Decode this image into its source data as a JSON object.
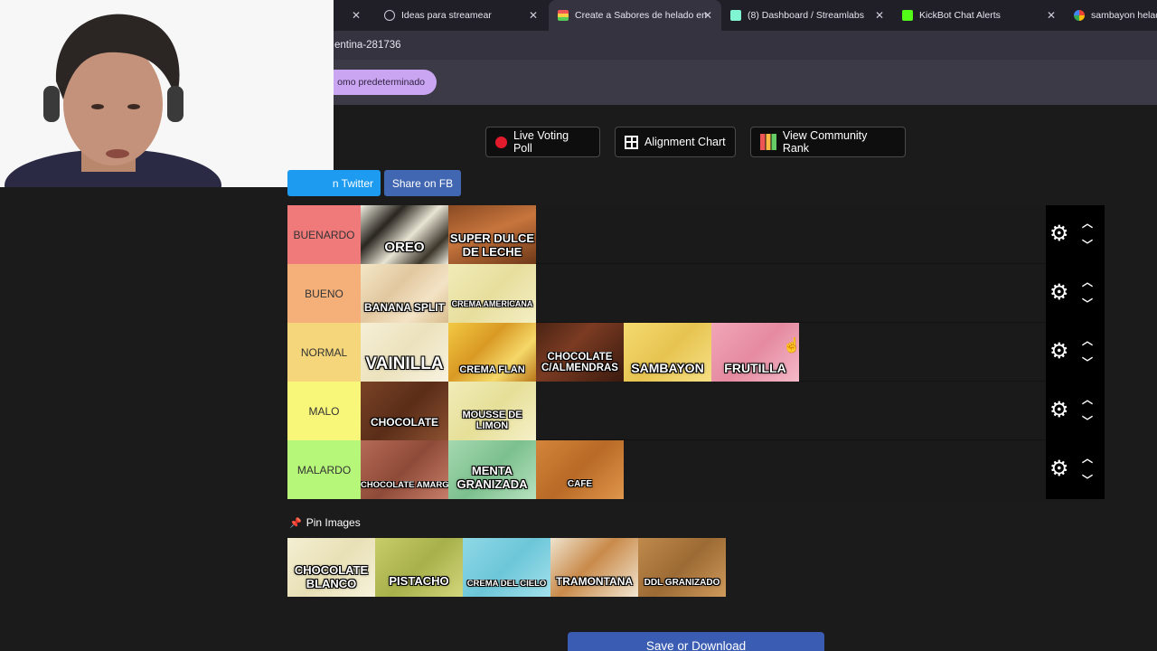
{
  "browser": {
    "tabs": [
      {
        "label": "Ideas para streamear",
        "active": false,
        "icon": "globe-icon"
      },
      {
        "label": "Create a Sabores de helado en",
        "active": true,
        "icon": "tiermaker-icon"
      },
      {
        "label": "(8) Dashboard / Streamlabs",
        "active": false,
        "icon": "streamlabs-icon"
      },
      {
        "label": "KickBot Chat Alerts",
        "active": false,
        "icon": "kickbot-icon"
      },
      {
        "label": "sambayon helad",
        "active": false,
        "icon": "google-icon"
      }
    ],
    "first_tab_close": "✕",
    "url_fragment": "entina-281736",
    "bookmark_pill": "omo predeterminado"
  },
  "toolbar": {
    "live_voting": "Live Voting Poll",
    "alignment_chart": "Alignment Chart",
    "community_rank": "View Community Rank",
    "share_twitter": "n Twitter",
    "share_fb": "Share on FB"
  },
  "tiers": [
    {
      "label": "BUENARDO",
      "color": "#f07a7a",
      "items": [
        {
          "text": "OREO",
          "bg": "linear-gradient(135deg,#f2efe2 0%,#2a2620 30%,#e9e5d4 55%,#3b352a 80%,#f1ede0 100%)"
        },
        {
          "text": "SUPER DULCE DE LECHE",
          "bg": "linear-gradient(160deg,#8a4a22 0%,#c7753d 45%,#6e3818 100%)"
        }
      ]
    },
    {
      "label": "BUENO",
      "color": "#f5b07a",
      "items": [
        {
          "text": "BANANA SPLIT",
          "bg": "linear-gradient(135deg,#f4e7c6 0%,#e2c8a0 40%,#f3e3c5 70%,#d9bb8c 100%)"
        },
        {
          "text": "CREMA AMERICANA",
          "bg": "linear-gradient(135deg,#f1ebb8 0%,#e7de9d 50%,#f4efc5 100%)"
        }
      ]
    },
    {
      "label": "NORMAL",
      "color": "#f5d67a",
      "items": [
        {
          "text": "VAINILLA",
          "bg": "linear-gradient(135deg,#f5efd6 0%,#ece2bd 50%,#f8f3e1 100%)"
        },
        {
          "text": "CREMA FLAN",
          "bg": "linear-gradient(135deg,#f2c943 0%,#d99a24 40%,#f5d869 70%,#b9761b 100%)"
        },
        {
          "text": "CHOCOLATE C/ALMENDRAS",
          "bg": "linear-gradient(135deg,#4a2414 0%,#7b3b22 40%,#3a1a0e 100%)"
        },
        {
          "text": "SAMBAYON",
          "bg": "linear-gradient(135deg,#f4da6f 0%,#e7c451 50%,#f6e085 100%)"
        },
        {
          "text": "FRUTILLA",
          "bg": "linear-gradient(135deg,#f2a6b8 0%,#e58aa1 50%,#f5b9c8 100%)"
        }
      ]
    },
    {
      "label": "MALO",
      "color": "#f8f77a",
      "items": [
        {
          "text": "CHOCOLATE",
          "bg": "linear-gradient(135deg,#7a4326 0%,#5a2d18 50%,#8c5131 100%)"
        },
        {
          "text": "MOUSSE DE LIMON",
          "bg": "linear-gradient(135deg,#f1ecb8 0%,#e6df98 50%,#f5f0c8 100%)"
        }
      ]
    },
    {
      "label": "MALARDO",
      "color": "#b6f77a",
      "items": [
        {
          "text": "CHOCOLATE AMARGO",
          "bg": "linear-gradient(135deg,#b56a56 0%,#8e4a38 50%,#c77e69 100%)"
        },
        {
          "text": "MENTA GRANIZADA",
          "bg": "linear-gradient(135deg,#a5d8b0 0%,#7cc08e 50%,#b7e3c0 100%)"
        },
        {
          "text": "CAFÉ",
          "bg": "linear-gradient(135deg,#d4853a 0%,#b86a26 50%,#e0964c 100%)"
        }
      ]
    }
  ],
  "pin_images": {
    "label": "Pin Images",
    "items": [
      {
        "text": "CHOCOLATE BLANCO",
        "bg": "linear-gradient(135deg,#f4efd3 0%,#e8e0b5 50%,#f7f2dc 100%)"
      },
      {
        "text": "PISTACHO",
        "bg": "linear-gradient(135deg,#c8cd6a 0%,#a7b04a 50%,#d3d77d 100%)"
      },
      {
        "text": "CREMA DEL CIELO",
        "bg": "linear-gradient(135deg,#8fd8e6 0%,#6cc6d8 50%,#a4e1ec 100%)"
      },
      {
        "text": "TRAMONTANA",
        "bg": "linear-gradient(135deg,#efe4cf 0%,#c98a4a 45%,#f2e7d2 100%)"
      },
      {
        "text": "DDL GRANIZADO",
        "bg": "linear-gradient(135deg,#c08a4c 0%,#9c6a34 50%,#cf9a5c 100%)"
      }
    ]
  },
  "save_button": "Save or Download",
  "icons": {
    "gear": "gear-icon",
    "up": "chevron-up-icon",
    "down": "chevron-down-icon",
    "pin": "pin-icon"
  }
}
